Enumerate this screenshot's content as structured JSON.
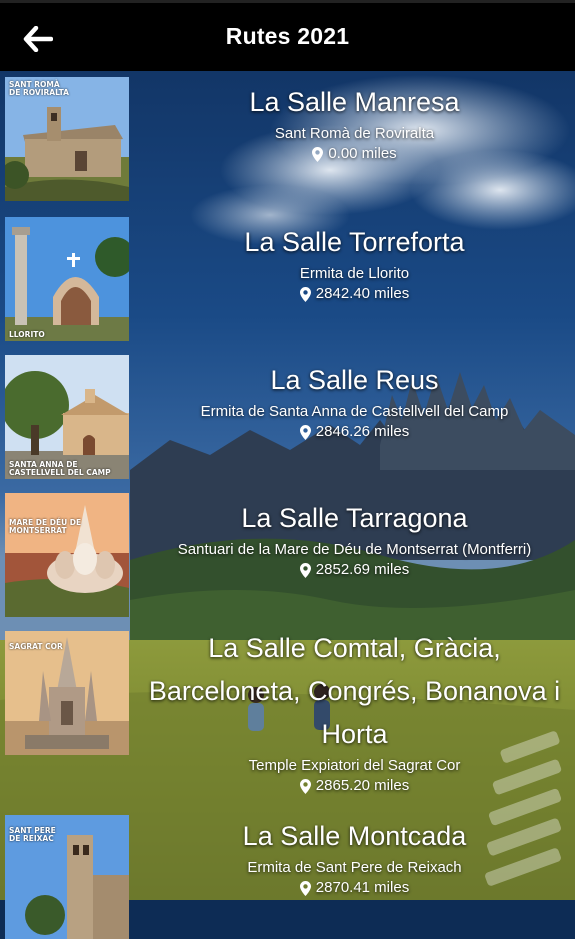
{
  "header": {
    "title": "Rutes 2021",
    "back_icon": "arrow-left-icon"
  },
  "routes": [
    {
      "name": "La Salle Manresa",
      "place": "Sant Romà de Roviralta",
      "distance": "0.00 miles",
      "thumb_label": "SANT ROMÀ\nDE ROVIRALTA"
    },
    {
      "name": "La Salle Torreforta",
      "place": "Ermita de Llorito",
      "distance": "2842.40 miles",
      "thumb_label": "LLORITO"
    },
    {
      "name": "La Salle Reus",
      "place": "Ermita de Santa Anna de Castellvell del Camp",
      "distance": "2846.26 miles",
      "thumb_label": "SANTA ANNA DE\nCASTELLVELL DEL CAMP"
    },
    {
      "name": "La Salle Tarragona",
      "place": "Santuari de la Mare de Déu de Montserrat (Montferri)",
      "distance": "2852.69 miles",
      "thumb_label": "MARE DE DÉU DE\nMONTSERRAT"
    },
    {
      "name": "La Salle Comtal, Gràcia, Barceloneta, Congrés, Bonanova i Horta",
      "place": "Temple Expiatori del Sagrat Cor",
      "distance": "2865.20 miles",
      "thumb_label": "SAGRAT COR"
    },
    {
      "name": "La Salle Montcada",
      "place": "Ermita de Sant Pere de Reixach",
      "distance": "2870.41 miles",
      "thumb_label": "SANT PERE\nDE REIXAC"
    }
  ],
  "colors": {
    "header_bg": "#000000",
    "text": "#ffffff"
  }
}
